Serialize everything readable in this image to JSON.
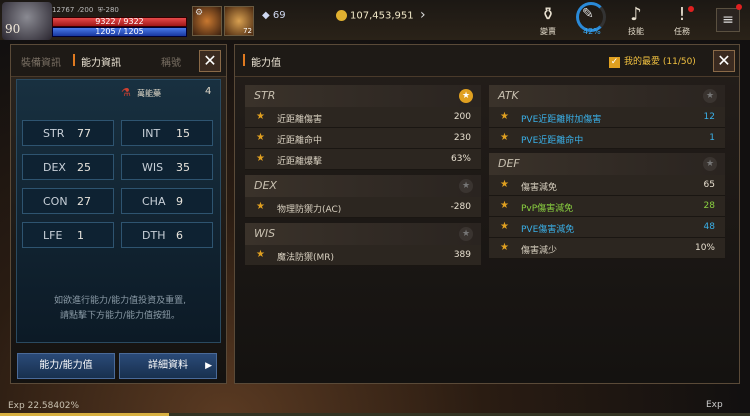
{
  "hud": {
    "level": "90",
    "stat_a": "12767",
    "stat_b": "200",
    "stat_c": "-280",
    "hp": "9322 / 9322",
    "mp": "1205 / 1205",
    "slot2_count": "72",
    "gems": "69",
    "gold": "107,453,951",
    "icons": [
      {
        "name": "交易所-icon",
        "label": "變賣"
      },
      {
        "name": "progress-ring",
        "label": "42%"
      },
      {
        "name": "skill-icon",
        "label": "技能"
      },
      {
        "name": "quest-icon",
        "label": "任務"
      }
    ],
    "sale_label": "變賣",
    "ring_pct": "42%",
    "skill_label": "技能",
    "quest_label": "任務",
    "menu_icon": "hamburger-menu-icon"
  },
  "left_panel": {
    "tabs": [
      "裝備資訊",
      "能力資訊",
      "稱號"
    ],
    "potion_label": "萬能藥",
    "potion_count": "4",
    "stats": [
      {
        "name": "STR",
        "value": "77"
      },
      {
        "name": "INT",
        "value": "15"
      },
      {
        "name": "DEX",
        "value": "25"
      },
      {
        "name": "WIS",
        "value": "35"
      },
      {
        "name": "CON",
        "value": "27"
      },
      {
        "name": "CHA",
        "value": "9"
      },
      {
        "name": "LFE",
        "value": "1"
      },
      {
        "name": "DTH",
        "value": "6"
      }
    ],
    "note_line1": "如欲進行能力/能力值投資及重置,",
    "note_line2": "請點擊下方能力/能力值按鈕。",
    "btn_ability": "能力/能力值",
    "btn_detail": "詳細資料"
  },
  "right_panel": {
    "title": "能力值",
    "favorites": "我的最愛 (11/50)",
    "sections": {
      "str": {
        "name": "STR",
        "rows": [
          {
            "label": "近距離傷害",
            "value": "200"
          },
          {
            "label": "近距離命中",
            "value": "230"
          },
          {
            "label": "近距離爆擊",
            "value": "63%"
          }
        ]
      },
      "dex": {
        "name": "DEX",
        "rows": [
          {
            "label": "物理防禦力(AC)",
            "value": "-280"
          }
        ]
      },
      "wis": {
        "name": "WIS",
        "rows": [
          {
            "label": "魔法防禦(MR)",
            "value": "389"
          }
        ]
      },
      "atk": {
        "name": "ATK",
        "rows": [
          {
            "label": "PVE近距離附加傷害",
            "value": "12"
          },
          {
            "label": "PVE近距離命中",
            "value": "1"
          }
        ]
      },
      "def": {
        "name": "DEF",
        "rows": [
          {
            "label": "傷害減免",
            "value": "65"
          },
          {
            "label": "PvP傷害減免",
            "value": "28"
          },
          {
            "label": "PVE傷害減免",
            "value": "48"
          },
          {
            "label": "傷害減少",
            "value": "10%"
          }
        ]
      }
    }
  },
  "bottom": {
    "exp": "Exp 22.58402%",
    "exp_fraction": 0.2258,
    "right_label": "Exp"
  }
}
